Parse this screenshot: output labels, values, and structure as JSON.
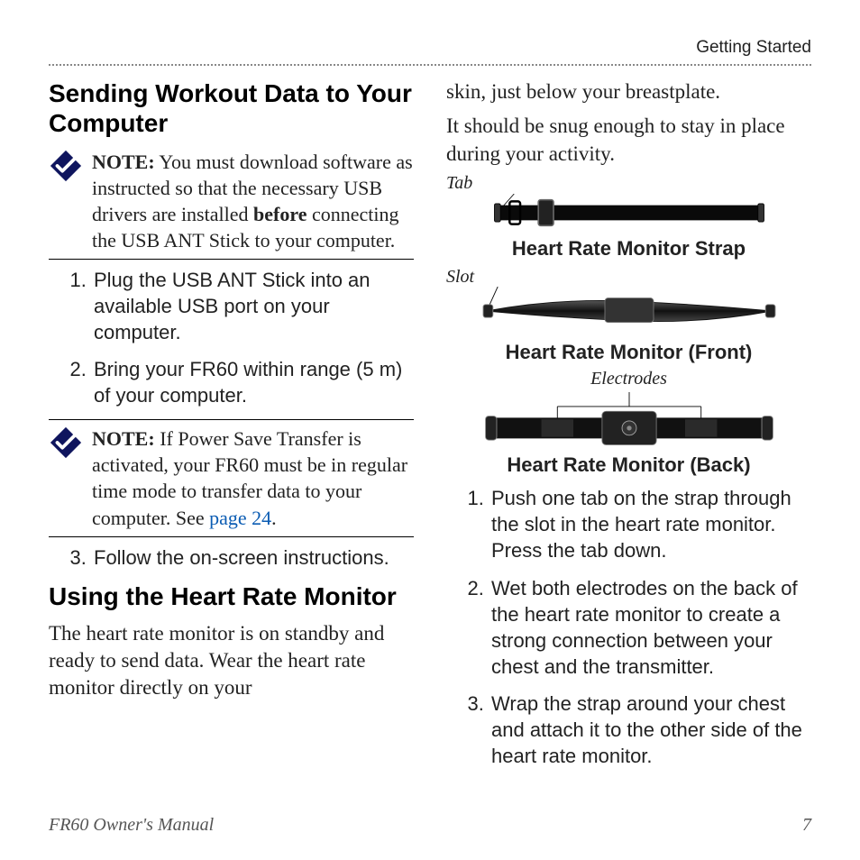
{
  "section_header": "Getting Started",
  "left": {
    "heading1": "Sending Workout Data to Your Computer",
    "note1_prefix": "NOTE:",
    "note1_body": " You must download software as instructed so that the necessary USB drivers are installed ",
    "note1_bold": "before",
    "note1_tail": " connecting the USB ANT Stick to your computer.",
    "steps1": [
      "Plug the USB ANT Stick into an available USB port on your computer.",
      "Bring your FR60 within range (5 m) of your computer."
    ],
    "note2_prefix": "NOTE:",
    "note2_body": " If Power Save Transfer is activated, your FR60 must be in regular time mode to transfer data to your computer. See ",
    "note2_link": "page 24",
    "note2_tail": ".",
    "step3": "Follow the on-screen instructions.",
    "heading2": "Using the Heart Rate Monitor",
    "paragraph2": "The heart rate monitor is on standby and ready to send data. Wear the heart rate monitor directly on your"
  },
  "right": {
    "continued1": "skin, just below your breastplate.",
    "continued2": "It should be snug enough to stay in place during your activity.",
    "label_tab": "Tab",
    "caption_strap": "Heart Rate Monitor Strap",
    "label_slot": "Slot",
    "caption_front": "Heart Rate Monitor (Front)",
    "label_electrodes": "Electrodes",
    "caption_back": "Heart Rate Monitor (Back)",
    "steps": [
      "Push one tab on the strap through the slot in the heart rate monitor. Press the tab down.",
      "Wet both electrodes on the back of the heart rate monitor to create a strong connection between your chest and the transmitter.",
      "Wrap the strap around your chest and attach it to the other side of the heart rate monitor."
    ]
  },
  "footer_left": "FR60 Owner's Manual",
  "footer_right": "7",
  "icons": {
    "note": "note-checklist-icon"
  }
}
